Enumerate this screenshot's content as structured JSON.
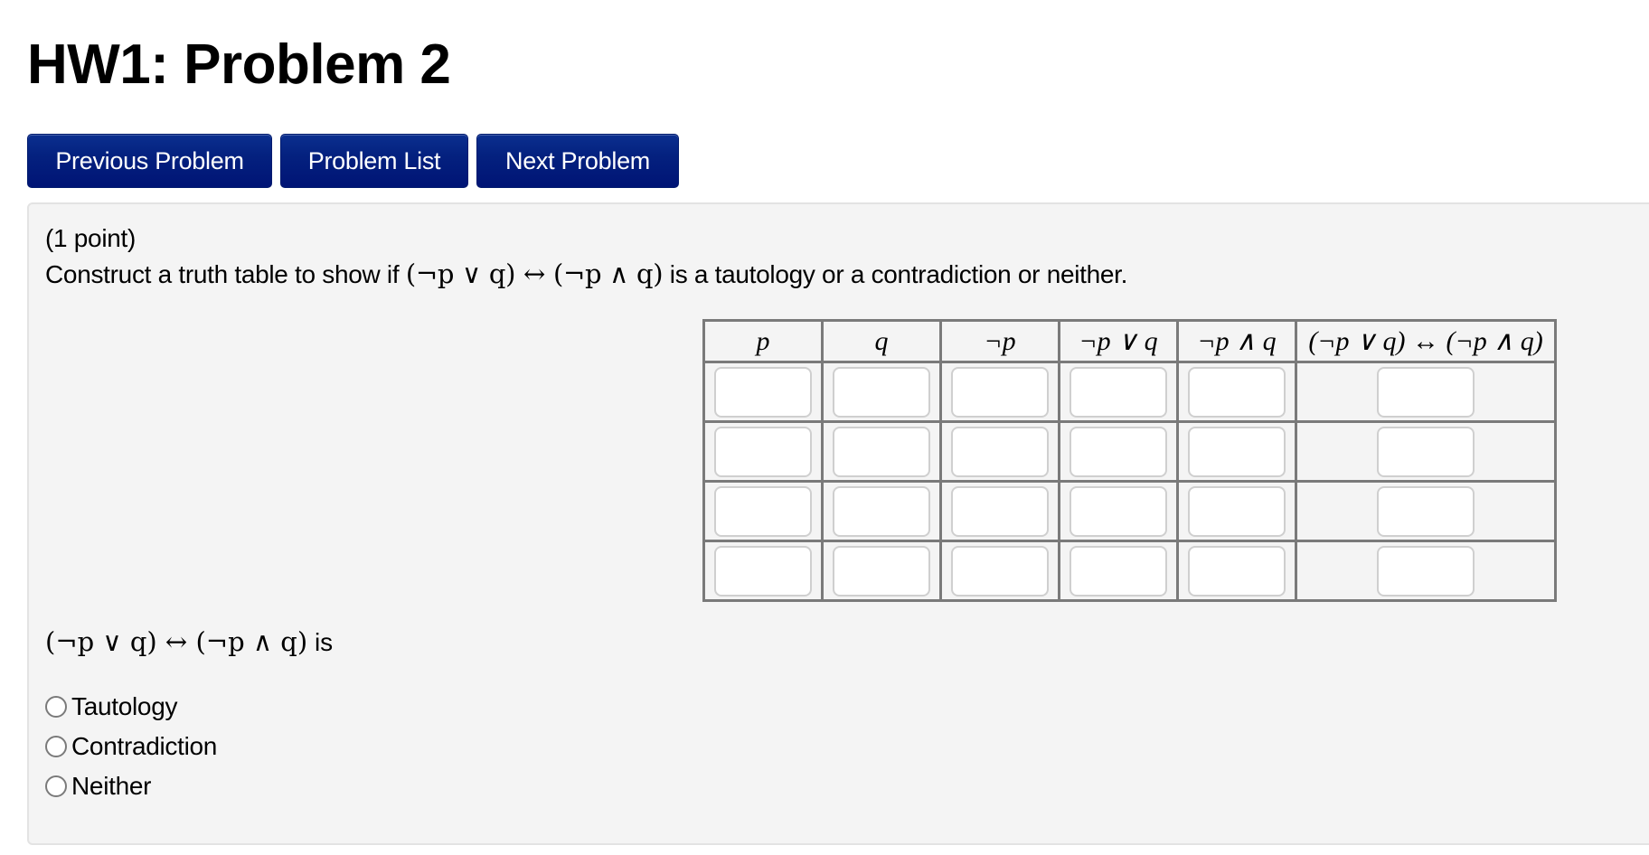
{
  "page": {
    "title": "HW1: Problem 2"
  },
  "nav": {
    "previous_label": "Previous Problem",
    "list_label": "Problem List",
    "next_label": "Next Problem",
    "button_color": "#04217f"
  },
  "problem": {
    "points": "(1 point)",
    "prompt_before": "Construct a truth table to show if ",
    "prompt_expr": "(¬p ∨ q) ↔ (¬p ∧ q)",
    "prompt_after": " is a tautology or a contradiction or neither."
  },
  "truth_table": {
    "headers": [
      "p",
      "q",
      "¬p",
      "¬p ∨ q",
      "¬p ∧ q",
      "(¬p ∨ q) ↔ (¬p ∧ q)"
    ],
    "rows": [
      [
        "",
        "",
        "",
        "",
        "",
        ""
      ],
      [
        "",
        "",
        "",
        "",
        "",
        ""
      ],
      [
        "",
        "",
        "",
        "",
        "",
        ""
      ],
      [
        "",
        "",
        "",
        "",
        "",
        ""
      ]
    ]
  },
  "answer": {
    "expr": "(¬p ∨ q) ↔ (¬p ∧ q)",
    "suffix": " is",
    "options": [
      "Tautology",
      "Contradiction",
      "Neither"
    ],
    "selected": null
  }
}
